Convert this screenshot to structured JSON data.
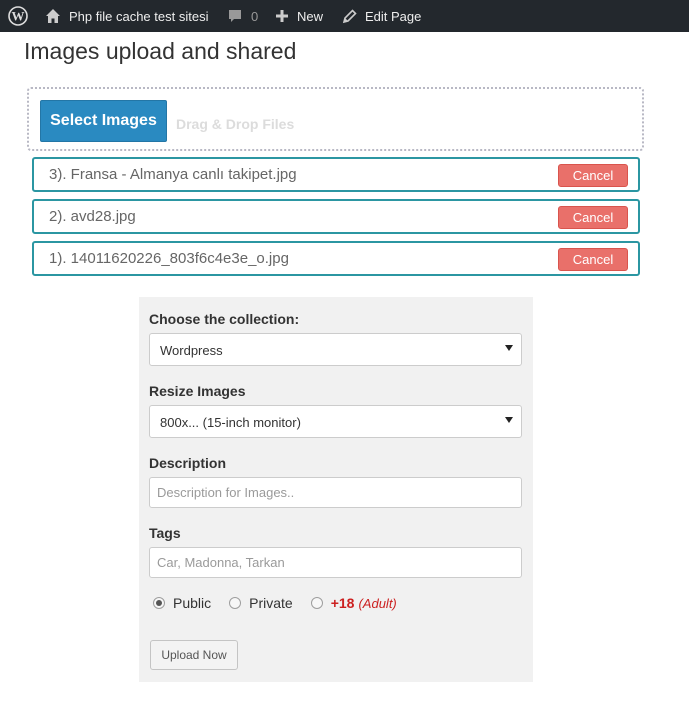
{
  "adminbar": {
    "logo_icon": "wordpress-icon",
    "site_icon": "home-icon",
    "site_name": "Php file cache test sitesi",
    "comments_icon": "comment-bubble-icon",
    "comments_count": "0",
    "new_icon": "plus-icon",
    "new_label": "New",
    "edit_icon": "pencil-icon",
    "edit_label": "Edit Page",
    "background": "#23282d"
  },
  "page": {
    "title": "Images upload and shared"
  },
  "uploader": {
    "select_label": "Select Images",
    "drag_drop_label": "Drag & Drop Files",
    "button_color": "#2a8ac1",
    "files": [
      {
        "name": "3). Fransa - Almanya canlı takipet.jpg",
        "cancel_label": "Cancel"
      },
      {
        "name": "2). avd28.jpg",
        "cancel_label": "Cancel"
      },
      {
        "name": "1). 14011620226_803f6c4e3e_o.jpg",
        "cancel_label": "Cancel"
      }
    ],
    "row_border_color": "#2b96a2",
    "cancel_color": "#e9706a"
  },
  "form": {
    "collection_label": "Choose the collection:",
    "collection_value": "Wordpress",
    "resize_label": "Resize Images",
    "resize_value": "800x... (15-inch monitor)",
    "description_label": "Description",
    "description_placeholder": "Description for Images..",
    "tags_label": "Tags",
    "tags_placeholder": "Car, Madonna, Tarkan",
    "privacy": {
      "public_label": "Public",
      "private_label": "Private",
      "adult_plus": "+18",
      "adult_note": "(Adult)",
      "selected": "Public"
    },
    "upload_label": "Upload Now"
  }
}
